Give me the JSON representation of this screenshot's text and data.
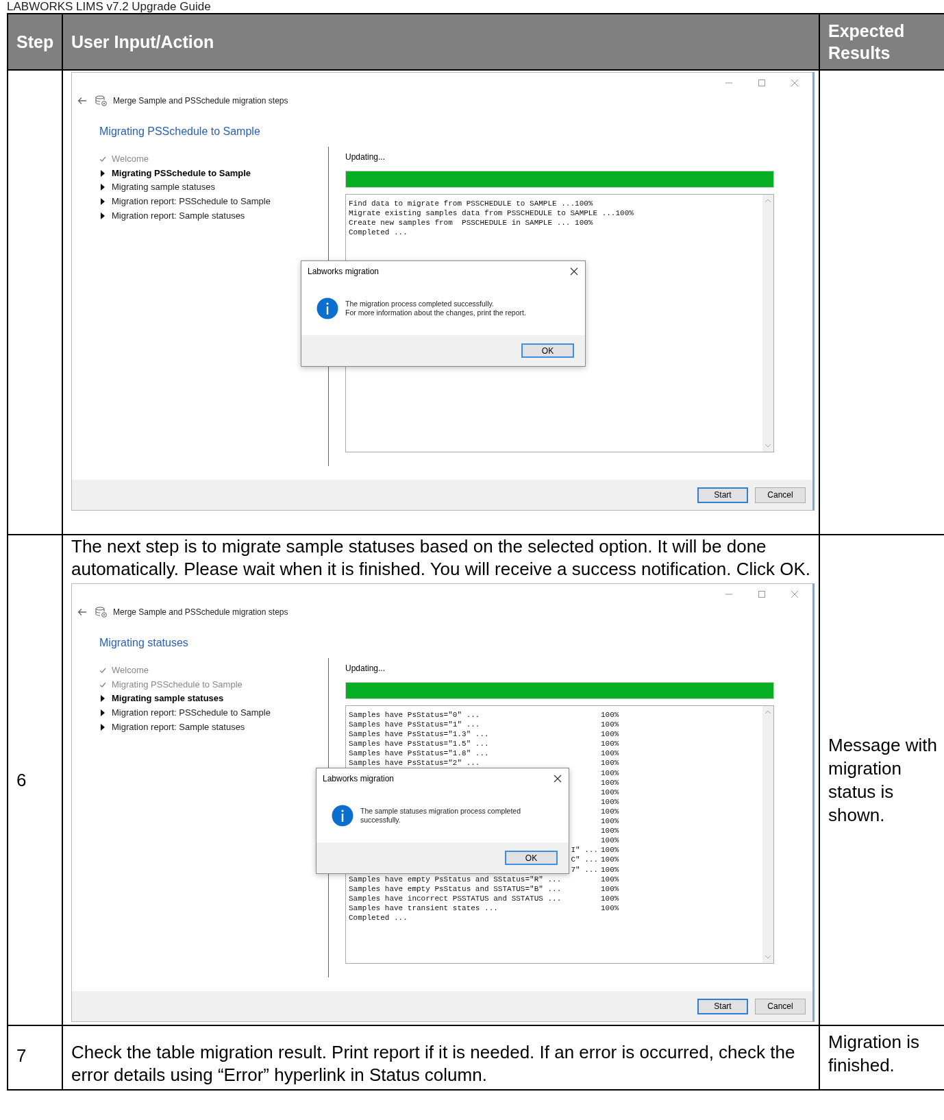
{
  "doc_title": "LABWORKS LIMS v7.2 Upgrade Guide",
  "table": {
    "columns": [
      "Step",
      "User Input/Action",
      "Expected Results"
    ],
    "rows": [
      {
        "action": [
          {
            "kind": "screenshot",
            "nav_title": "Merge Sample and PSSchedule migration steps",
            "heading": "Migrating PSSchedule to Sample",
            "steps": [
              {
                "label": "Welcome",
                "kind": "done"
              },
              {
                "label": "Migrating PSSchedule to Sample",
                "kind": "current"
              },
              {
                "label": "Migrating sample statuses",
                "kind": "pending"
              },
              {
                "label": "Migration report: PSSchedule to Sample",
                "kind": "pending"
              },
              {
                "label": "Migration report: Sample statuses",
                "kind": "pending"
              }
            ],
            "status_label": "Updating...",
            "progress": {
              "level": 1
            },
            "log": [
              {
                "kind": "full",
                "text": "Find data to migrate from PSSCHEDULE to SAMPLE ...100%"
              },
              {
                "kind": "full",
                "text": "Migrate existing samples data from PSSCHEDULE to SAMPLE ...100%"
              },
              {
                "kind": "full",
                "text": "Create new samples from  PSSCHEDULE in SAMPLE ... 100%"
              },
              {
                "kind": "full",
                "text": "Completed ..."
              }
            ],
            "buttons": [
              {
                "label": "Start",
                "default": true
              },
              {
                "label": "Cancel",
                "default": false
              }
            ],
            "dialog": {
              "title": "Labworks migration",
              "message": [
                "The migration process completed successfully.",
                "For more information about the changes, print the report."
              ],
              "button": "OK"
            }
          }
        ]
      },
      {
        "step": "6",
        "action": [
          {
            "kind": "paragraph",
            "text": "The next step is to migrate sample statuses based on the selected option. It will be done automatically. Please wait when it is finished. You will receive a success notification. Click OK."
          },
          {
            "kind": "screenshot",
            "nav_title": "Merge Sample and PSSchedule migration steps",
            "heading": "Migrating statuses",
            "steps": [
              {
                "label": "Welcome",
                "kind": "done"
              },
              {
                "label": "Migrating PSSchedule to Sample",
                "kind": "done"
              },
              {
                "label": "Migrating sample statuses",
                "kind": "current"
              },
              {
                "label": "Migration report: PSSchedule to Sample",
                "kind": "pending"
              },
              {
                "label": "Migration report: Sample statuses",
                "kind": "pending"
              }
            ],
            "status_label": "Updating...",
            "progress": {
              "level": 1
            },
            "log": [
              {
                "kind": "full",
                "text": "Samples have PsStatus=\"0\" ...",
                "percent": "100%"
              },
              {
                "kind": "full",
                "text": "Samples have PsStatus=\"1\" ...",
                "percent": "100%"
              },
              {
                "kind": "full",
                "text": "Samples have PsStatus=\"1.3\" ...",
                "percent": "100%"
              },
              {
                "kind": "full",
                "text": "Samples have PsStatus=\"1.5\" ...",
                "percent": "100%"
              },
              {
                "kind": "full",
                "text": "Samples have PsStatus=\"1.8\" ...",
                "percent": "100%"
              },
              {
                "kind": "full",
                "text": "Samples have PsStatus=\"2\" ...",
                "percent": "100%"
              },
              {
                "kind": "hidden",
                "percent": "100%"
              },
              {
                "kind": "hidden",
                "percent": "100%"
              },
              {
                "kind": "hidden",
                "percent": "100%"
              },
              {
                "kind": "hidden",
                "percent": "100%"
              },
              {
                "kind": "hidden",
                "percent": "100%"
              },
              {
                "kind": "hidden",
                "percent": "100%"
              },
              {
                "kind": "hidden",
                "percent": "100%"
              },
              {
                "kind": "hidden",
                "percent": "100%"
              },
              {
                "kind": "partial",
                "text": "I\" ...",
                "percent": "100%"
              },
              {
                "kind": "partial",
                "text": "C\" ...",
                "percent": "100%"
              },
              {
                "kind": "partial",
                "text": "7\" ...",
                "percent": "100%"
              },
              {
                "kind": "full",
                "text": "Samples have empty PsStatus and SStatus=\"R\" ...",
                "percent": "100%"
              },
              {
                "kind": "full",
                "text": "Samples have empty PsStatus and SSTATUS=\"B\" ...",
                "percent": "100%"
              },
              {
                "kind": "full",
                "text": "Samples have incorrect PSSTATUS and SSTATUS ...",
                "percent": "100%"
              },
              {
                "kind": "full",
                "text": "Samples have transient states ...",
                "percent": "100%"
              },
              {
                "kind": "full",
                "text": "Completed ..."
              }
            ],
            "buttons": [
              {
                "label": "Start",
                "default": true
              },
              {
                "label": "Cancel",
                "default": false
              }
            ],
            "dialog": {
              "title": "Labworks migration",
              "message": [
                "The sample statuses migration process completed successfully."
              ],
              "button": "OK"
            }
          }
        ],
        "expected": "Message with migration status is shown."
      },
      {
        "step": "7",
        "action": [
          {
            "kind": "paragraph",
            "text": "Check the table migration result. Print report if it is needed. If an error is occurred, check the error details using “Error” hyperlink in Status column."
          }
        ],
        "expected": "Migration is finished."
      }
    ]
  }
}
